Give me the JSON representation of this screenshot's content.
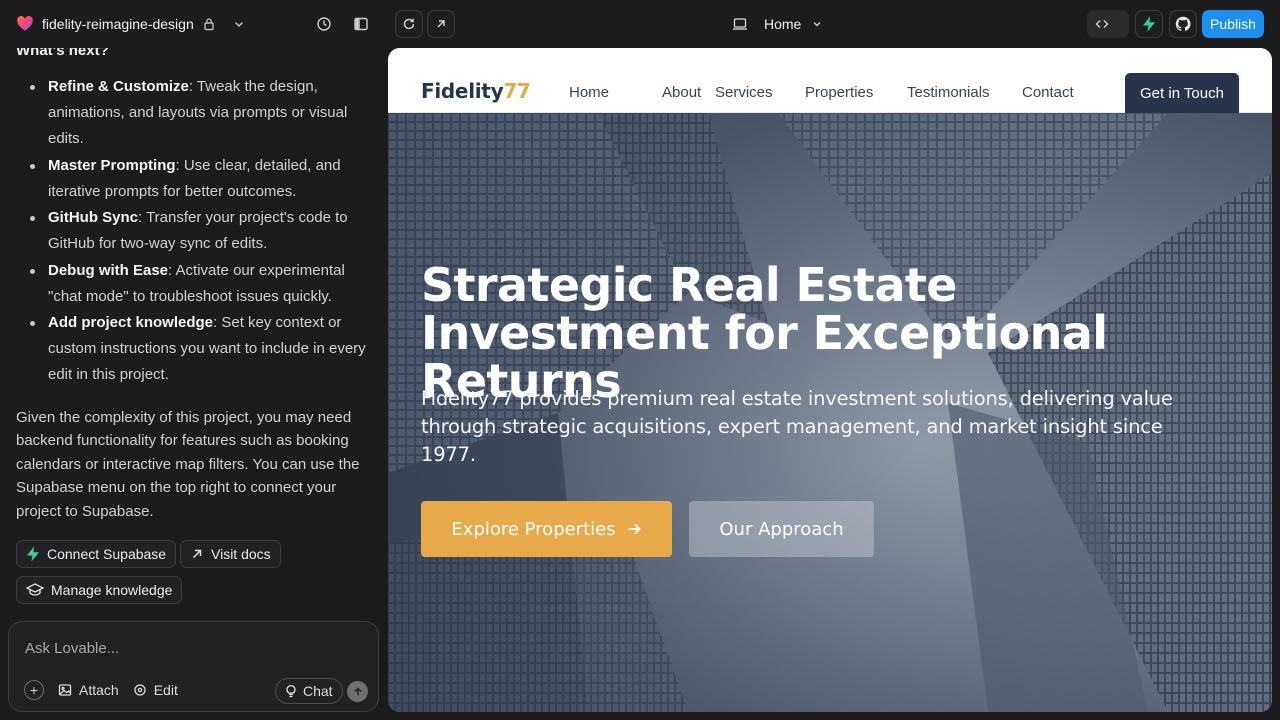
{
  "topbar": {
    "project_name": "fidelity-reimagine-design",
    "route_label": "Home",
    "publish_label": "Publish",
    "code_icon": "code-icon"
  },
  "chat": {
    "heading": "What's next?",
    "items": [
      {
        "title": "Refine & Customize",
        "text": ": Tweak the design, animations, and layouts via prompts or visual edits."
      },
      {
        "title": "Master Prompting",
        "text": ": Use clear, detailed, and iterative prompts for better outcomes."
      },
      {
        "title": "GitHub Sync",
        "text": ": Transfer your project's code to GitHub for two-way sync of edits."
      },
      {
        "title": "Debug with Ease",
        "text": ": Activate our experimental \"chat mode\" to troubleshoot issues quickly."
      },
      {
        "title": "Add project knowledge",
        "text": ": Set key context or custom instructions you want to include in every edit in this project."
      }
    ],
    "paragraph": "Given the complexity of this project, you may need backend functionality for features such as booking calendars or interactive map filters. You can use the Supabase menu on the top right to connect your project to Supabase.",
    "actions": {
      "connect_supabase": "Connect Supabase",
      "visit_docs": "Visit docs",
      "manage_knowledge": "Manage knowledge"
    },
    "composer": {
      "placeholder": "Ask Lovable...",
      "attach": "Attach",
      "edit": "Edit",
      "chat": "Chat"
    }
  },
  "site": {
    "logo_main": "Fidelity",
    "logo_accent": "77",
    "nav": [
      "Home",
      "About",
      "Services",
      "Properties",
      "Testimonials",
      "Contact"
    ],
    "cta": "Get in Touch",
    "hero_title": "Strategic Real Estate Investment for Exceptional Returns",
    "hero_sub": "Fidelity77 provides premium real estate investment solutions, delivering value through strategic acquisitions, expert management, and market insight since 1977.",
    "btn_primary": "Explore Properties",
    "btn_secondary": "Our Approach"
  },
  "colors": {
    "accent": "#e8a94a",
    "navy": "#27344c",
    "publish": "#1a8ff0",
    "supabase_green": "#3ecf8e"
  }
}
